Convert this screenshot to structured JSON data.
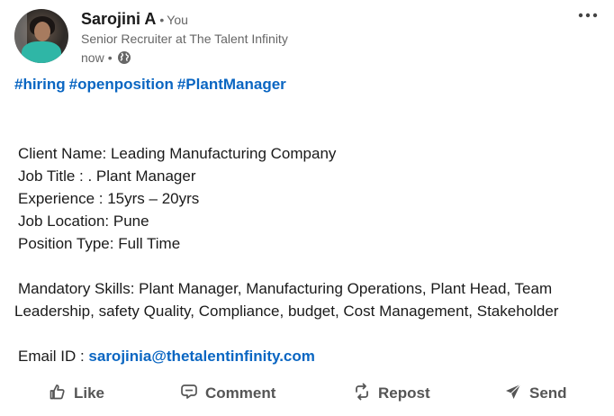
{
  "author": {
    "name": "Sarojini A",
    "relation_separator": "•",
    "relation": "You",
    "headline": "Senior Recruiter at The Talent Infinity",
    "time": "now",
    "time_separator": "•",
    "visibility_icon": "globe-icon"
  },
  "menu": {
    "icon": "more-horizontal-icon"
  },
  "hashtags": [
    "#hiring",
    "#openposition",
    "#PlantManager"
  ],
  "post": {
    "client_name": "Client Name: Leading Manufacturing Company",
    "job_title": "Job Title : . Plant Manager",
    "experience": "Experience : 15yrs – 20yrs",
    "job_location": "Job Location: Pune",
    "position_type": "Position Type: Full Time",
    "skills": "Mandatory Skills: Plant Manager, Manufacturing Operations, Plant Head, Team Leadership, safety Quality, Compliance, budget, Cost Management, Stakeholder",
    "email_label": "Email ID : ",
    "email": "sarojinia@thetalentinfinity.com"
  },
  "actions": {
    "like": {
      "label": "Like",
      "icon": "thumbs-up-icon"
    },
    "comment": {
      "label": "Comment",
      "icon": "comment-icon"
    },
    "repost": {
      "label": "Repost",
      "icon": "repost-icon"
    },
    "send": {
      "label": "Send",
      "icon": "send-icon"
    }
  },
  "colors": {
    "link": "#0a66c2",
    "text": "#1a1a1a",
    "secondary": "#666666"
  }
}
